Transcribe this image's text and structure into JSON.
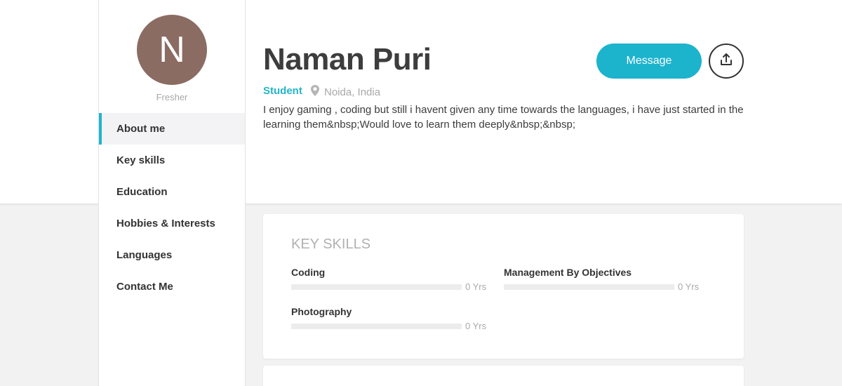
{
  "sidebar": {
    "avatar_initial": "N",
    "status": "Fresher",
    "nav": [
      {
        "label": "About me",
        "active": true
      },
      {
        "label": "Key skills",
        "active": false
      },
      {
        "label": "Education",
        "active": false
      },
      {
        "label": "Hobbies & Interests",
        "active": false
      },
      {
        "label": "Languages",
        "active": false
      },
      {
        "label": "Contact Me",
        "active": false
      }
    ]
  },
  "profile": {
    "name": "Naman Puri",
    "role": "Student",
    "location": "Noida, India",
    "about": "I enjoy gaming , coding but still i havent given any time towards the languages, i have just started in the learning them&nbsp;Would love to learn them deeply&nbsp;&nbsp;"
  },
  "actions": {
    "message_label": "Message",
    "share_icon": "share-upload-icon"
  },
  "key_skills": {
    "title": "KEY SKILLS",
    "skills": [
      {
        "name": "Coding",
        "years": "0 Yrs",
        "level": 0
      },
      {
        "name": "Management By Objectives",
        "years": "0 Yrs",
        "level": 0
      },
      {
        "name": "Photography",
        "years": "0 Yrs",
        "level": 0
      }
    ]
  },
  "colors": {
    "accent": "#1cb3cd",
    "avatar_bg": "#8b6c62"
  }
}
